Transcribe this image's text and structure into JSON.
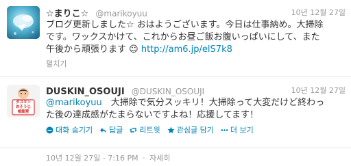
{
  "tweets": [
    {
      "fullname": "☆まりこ☆",
      "username": "@marikoyuu",
      "time": "10년 12월 27일",
      "text_lines": [
        "ブログ更新しました☆ おはようございます。今日は仕事納め。大掃除",
        "です。ワックスかけて、これからお昼ご飯お腹いっぱいにして、また"
      ],
      "text_line3": "午後から頑張ります ☺ ",
      "link": "http://am6.jp/elS7k8",
      "expand": "펼치기"
    },
    {
      "fullname": "DUSKIN_OSOUJI",
      "username": "@DUSKIN_OSOUJI",
      "time": "10년 12월 27일",
      "mention": "@marikoyuu",
      "text_line1": "　大掃除で気分スッキリ！大掃除って大変だけど終わっ",
      "text_line2": "た後の達成感がたまらないですよね！応援してます！",
      "avatar_text": [
        "ダスキン",
        "おそうじ",
        "相談室"
      ],
      "actions": {
        "hide": "대화 숨기기",
        "reply": "답글",
        "retweet": "리트윗",
        "favorite": "관심글 담기",
        "more": "더 보기"
      },
      "meta": {
        "time": "10년 12월 27일 - 7:16 PM",
        "detail": "자세히"
      }
    }
  ],
  "colors": {
    "link": "#0084b4",
    "muted": "#999999",
    "text": "#333333"
  },
  "icons": [
    "reply-icon",
    "retweet-icon",
    "favorite-icon",
    "more-icon",
    "hide-conversation-icon"
  ]
}
